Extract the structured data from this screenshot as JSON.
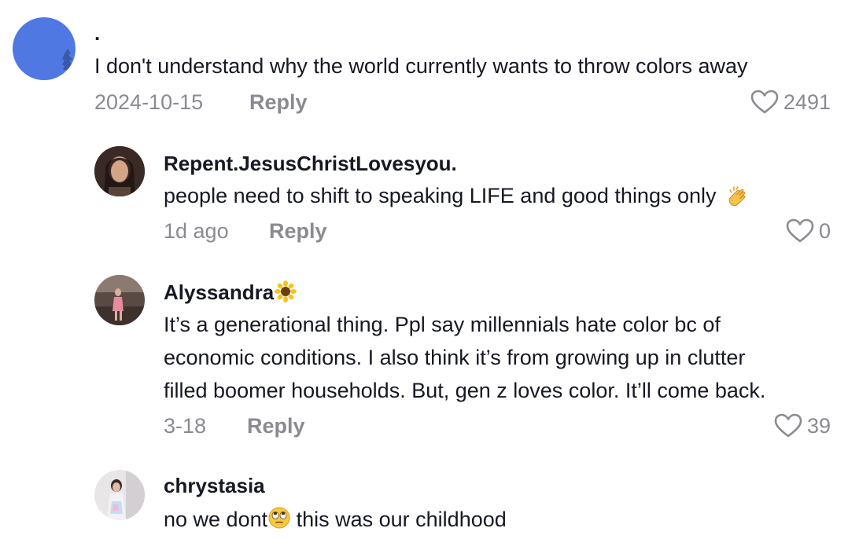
{
  "comments": [
    {
      "username": ".",
      "text": "I don't understand why the world currently wants to throw colors away",
      "date": "2024-10-15",
      "reply_label": "Reply",
      "likes": "2491",
      "avatar_color": "#4f78e2"
    }
  ],
  "replies": [
    {
      "username": "Repent.JesusChristLovesyou.",
      "text": "people need to shift to speaking LIFE and good things only",
      "emoji_icon": "clapping-hands-icon",
      "date": "1d ago",
      "reply_label": "Reply",
      "likes": "0"
    },
    {
      "username": "Alyssandra",
      "username_emoji_icon": "sunflower-icon",
      "text_lines": [
        "It’s a generational thing. Ppl say millennials hate color bc of",
        "economic conditions. I also think it’s from growing up in clutter",
        "filled boomer households. But, gen z loves color. It’ll come back."
      ],
      "date": "3-18",
      "reply_label": "Reply",
      "likes": "39"
    },
    {
      "username": "chrystasia",
      "text_before_emoji": "no we dont",
      "emoji_icon": "rolling-eyes-icon",
      "text_after_emoji": " this was our childhood"
    }
  ],
  "colors": {
    "text": "#161823",
    "muted": "#8a8b91",
    "avatar_blue": "#4f78e2"
  }
}
